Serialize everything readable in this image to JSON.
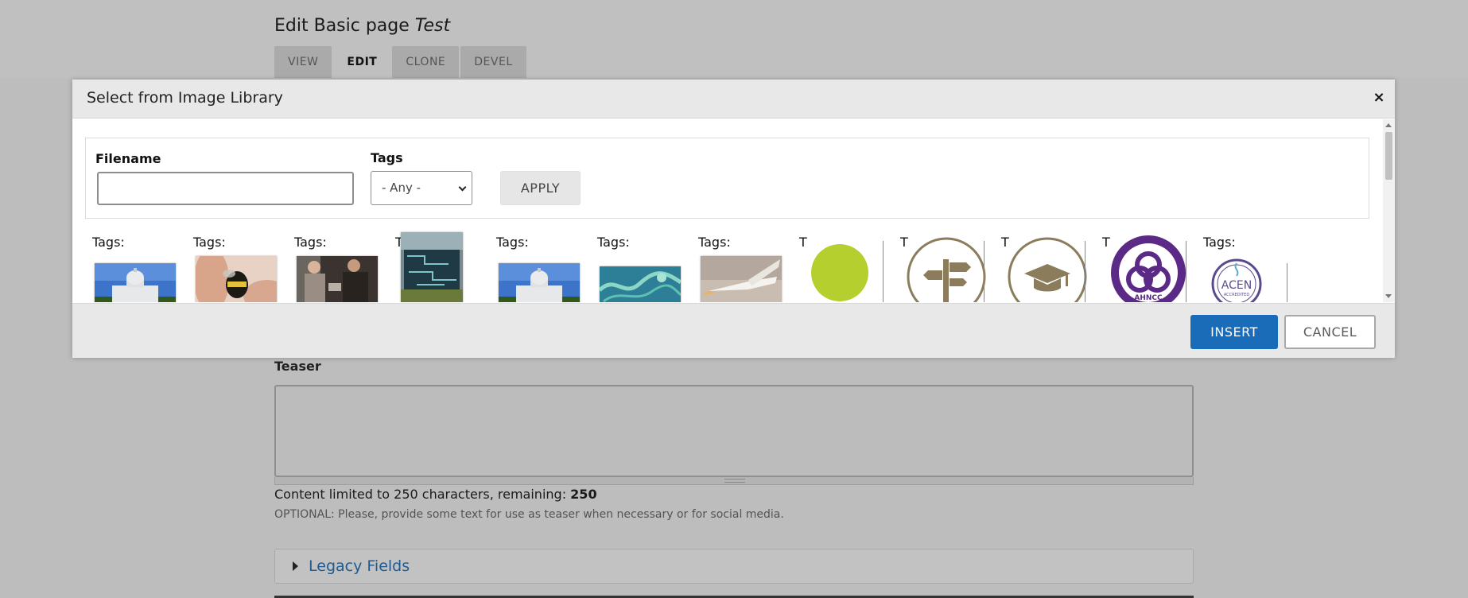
{
  "page": {
    "title_prefix": "Edit Basic page",
    "title_node": "Test",
    "tabs": [
      {
        "label": "View",
        "active": false
      },
      {
        "label": "Edit",
        "active": true
      },
      {
        "label": "Clone",
        "active": false
      },
      {
        "label": "Devel",
        "active": false
      }
    ],
    "teaser": {
      "label": "Teaser",
      "value": "",
      "limit_prefix": "Content limited to 250 characters, remaining:",
      "limit_remaining": "250",
      "help_text": "OPTIONAL: Please, provide some text for use as teaser when necessary or for social media."
    },
    "legacy_fields_label": "Legacy Fields"
  },
  "dialog": {
    "title": "Select from Image Library",
    "close_icon": "×",
    "filters": {
      "filename_label": "Filename",
      "filename_value": "",
      "tags_label": "Tags",
      "tags_selected": "- Any -",
      "apply_label": "Apply"
    },
    "images": [
      {
        "tag_label": "Tags:",
        "subject": "capitol-building-photo"
      },
      {
        "tag_label": "Tags:",
        "subject": "bumblebee-on-finger-photo"
      },
      {
        "tag_label": "Tags:",
        "subject": "people-in-lab-photo"
      },
      {
        "tag_label": "Tags",
        "subject": "circuit-sign-photo"
      },
      {
        "tag_label": "Tags:",
        "subject": "capitol-building-photo"
      },
      {
        "tag_label": "Tags:",
        "subject": "teal-abstract-photo"
      },
      {
        "tag_label": "Tags:",
        "subject": "pelican-photo"
      },
      {
        "tag_label": "T",
        "subject": "green-circle-graphic"
      },
      {
        "tag_label": "T",
        "subject": "signpost-icon"
      },
      {
        "tag_label": "T",
        "subject": "graduation-cap-icon"
      },
      {
        "tag_label": "T",
        "subject": "ahncc-seal-logo"
      },
      {
        "tag_label": "Tags:",
        "subject": "acen-accredited-logo"
      }
    ],
    "logo_text": {
      "ahncc": "AHNCC",
      "acen": "ACEN",
      "acen_sub": "ACCREDITED"
    },
    "footer": {
      "insert_label": "Insert",
      "cancel_label": "Cancel"
    }
  },
  "colors": {
    "primary": "#1a6cb8",
    "link": "#1e5a8f",
    "olive_icon": "#8b7d5c",
    "lime_circle": "#b5cf2e",
    "ahncc_purple": "#5b2a86"
  }
}
